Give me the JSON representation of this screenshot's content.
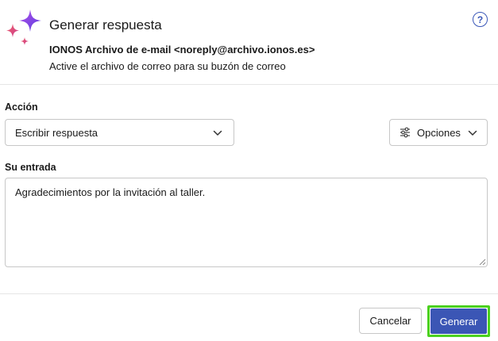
{
  "dialog": {
    "title": "Generar respuesta",
    "help_label": "?",
    "sender": "IONOS Archivo de e-mail <noreply@archivo.ionos.es>",
    "subject": "Active el archivo de correo para su buzón de correo"
  },
  "action": {
    "label": "Acción",
    "selected": "Escribir respuesta"
  },
  "options": {
    "label": "Opciones"
  },
  "input": {
    "label": "Su entrada",
    "value": "Agradecimientos por la invitación al taller."
  },
  "footer": {
    "cancel_label": "Cancelar",
    "generate_label": "Generar"
  },
  "colors": {
    "primary": "#3b56b5",
    "highlight": "#4bd11f",
    "help": "#3a57b8",
    "sparkle_purple": "#8a3fe0",
    "sparkle_pink": "#e0407a"
  },
  "icons": {
    "app": "sparkle-icon",
    "help": "help-icon",
    "dropdown": "chevron-down-icon",
    "options": "sliders-icon"
  }
}
